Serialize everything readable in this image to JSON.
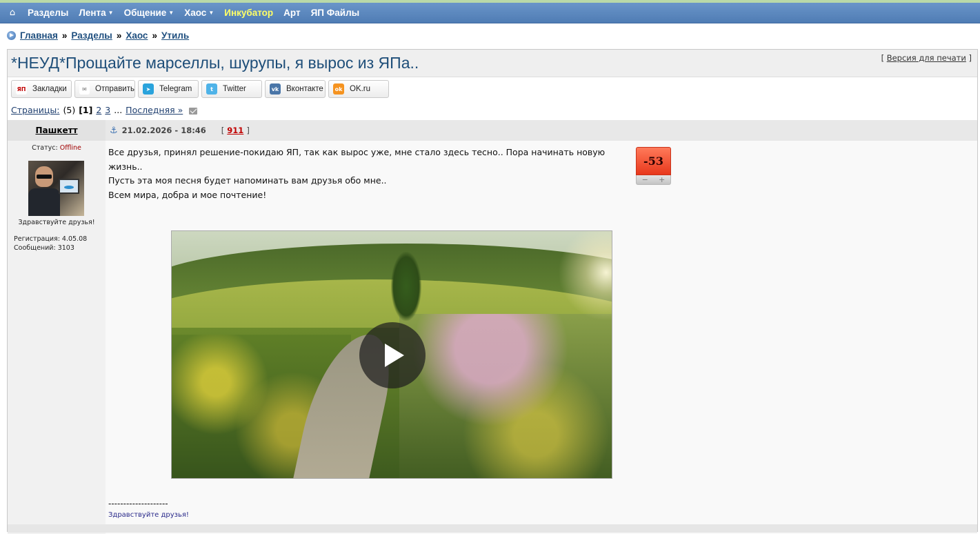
{
  "nav": {
    "home_icon": "home-icon",
    "items": [
      {
        "label": "Разделы",
        "dropdown": false,
        "highlight": false
      },
      {
        "label": "Лента",
        "dropdown": true,
        "highlight": false
      },
      {
        "label": "Общение",
        "dropdown": true,
        "highlight": false
      },
      {
        "label": "Хаос",
        "dropdown": true,
        "highlight": false
      },
      {
        "label": "Инкубатор",
        "dropdown": false,
        "highlight": true
      },
      {
        "label": "Арт",
        "dropdown": false,
        "highlight": false
      },
      {
        "label": "ЯП Файлы",
        "dropdown": false,
        "highlight": false
      }
    ],
    "colors": {
      "bar": "#5a86bd",
      "highlight": "#ffff66"
    }
  },
  "breadcrumb": {
    "items": [
      "Главная",
      "Разделы",
      "Хаос",
      "Утиль"
    ],
    "separator": "»"
  },
  "topic": {
    "title": "*НЕУД*Прощайте марселлы, шурупы, я вырос из ЯПа..",
    "print_bracket_open": "[",
    "print_label": "Версия для печати",
    "print_bracket_close": "]"
  },
  "share": [
    {
      "label": "Закладки",
      "icon": "yap-icon",
      "icon_text": "ЯП",
      "color": "#ffffff",
      "text_color": "#c00000"
    },
    {
      "label": "Отправить",
      "icon": "mail-icon",
      "icon_text": "✉",
      "color": "#ffffff",
      "text_color": "#777777"
    },
    {
      "label": "Telegram",
      "icon": "telegram-icon",
      "icon_text": "➤",
      "color": "#2aa3dc",
      "text_color": "#ffffff"
    },
    {
      "label": "Twitter",
      "icon": "twitter-icon",
      "icon_text": "t",
      "color": "#4fb3e8",
      "text_color": "#ffffff"
    },
    {
      "label": "Вконтакте",
      "icon": "vk-icon",
      "icon_text": "vk",
      "color": "#4a76a8",
      "text_color": "#ffffff"
    },
    {
      "label": "OK.ru",
      "icon": "ok-icon",
      "icon_text": "ok",
      "color": "#f59320",
      "text_color": "#ffffff"
    }
  ],
  "pagination": {
    "label": "Страницы:",
    "total": "(5)",
    "current": "[1]",
    "pages": [
      "2",
      "3"
    ],
    "ellipsis": "...",
    "last": "Последняя »"
  },
  "post": {
    "author": "Пашкетт",
    "date": "21.02.2026 - 18:46",
    "number_bracket_open": "[",
    "number": "911",
    "number_bracket_close": "]",
    "status_label": "Статус:",
    "status_value": "Offline",
    "motto": "Здравствуйте друзья!",
    "registration": "Регистрация: 4.05.08",
    "messages": "Сообщений: 3103",
    "text_lines": [
      "Все друзья, принял решение-покидаю ЯП, так как вырос уже, мне стало здесь тесно.. Пора начинать новую жизнь..",
      "Пусть эта моя песня будет напоминать вам друзья обо мне..",
      "Всем мира, добра и мое почтение!"
    ],
    "rating": "-53",
    "rating_minus": "−",
    "rating_plus": "+",
    "signature_divider": "--------------------",
    "signature": "Здравствуйте друзья!"
  }
}
